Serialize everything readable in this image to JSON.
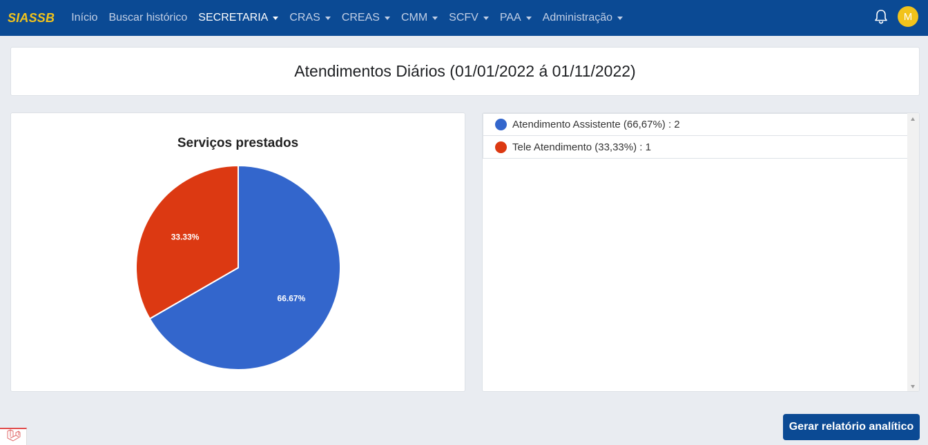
{
  "navbar": {
    "brand": "SIASSB",
    "items": [
      {
        "label": "Início",
        "dropdown": false,
        "active": false
      },
      {
        "label": "Buscar histórico",
        "dropdown": false,
        "active": false
      },
      {
        "label": "SECRETARIA",
        "dropdown": true,
        "active": true
      },
      {
        "label": "CRAS",
        "dropdown": true,
        "active": false
      },
      {
        "label": "CREAS",
        "dropdown": true,
        "active": false
      },
      {
        "label": "CMM",
        "dropdown": true,
        "active": false
      },
      {
        "label": "SCFV",
        "dropdown": true,
        "active": false
      },
      {
        "label": "PAA",
        "dropdown": true,
        "active": false
      },
      {
        "label": "Administração",
        "dropdown": true,
        "active": false
      }
    ],
    "avatar_initial": "M",
    "bell_icon": "bell-icon"
  },
  "page_title": "Atendimentos Diários (01/01/2022 á 01/11/2022)",
  "chart_data": {
    "type": "pie",
    "title": "Serviços prestados",
    "slices": [
      {
        "label": "Atendimento Assistente",
        "value": 2,
        "percent_label": "66.67%",
        "color": "#3366cc"
      },
      {
        "label": "Tele Atendimento",
        "value": 1,
        "percent_label": "33.33%",
        "color": "#dc3912"
      }
    ]
  },
  "legend": {
    "items": [
      {
        "text": "Atendimento Assistente (66,67%) : 2",
        "color": "#3366cc"
      },
      {
        "text": "Tele Atendimento (33,33%) : 1",
        "color": "#dc3912"
      }
    ]
  },
  "actions": {
    "report_button": "Gerar relatório analítico"
  },
  "colors": {
    "navbar": "#0b4a94",
    "brand": "#f2c31b",
    "background": "#e9ecf1"
  }
}
